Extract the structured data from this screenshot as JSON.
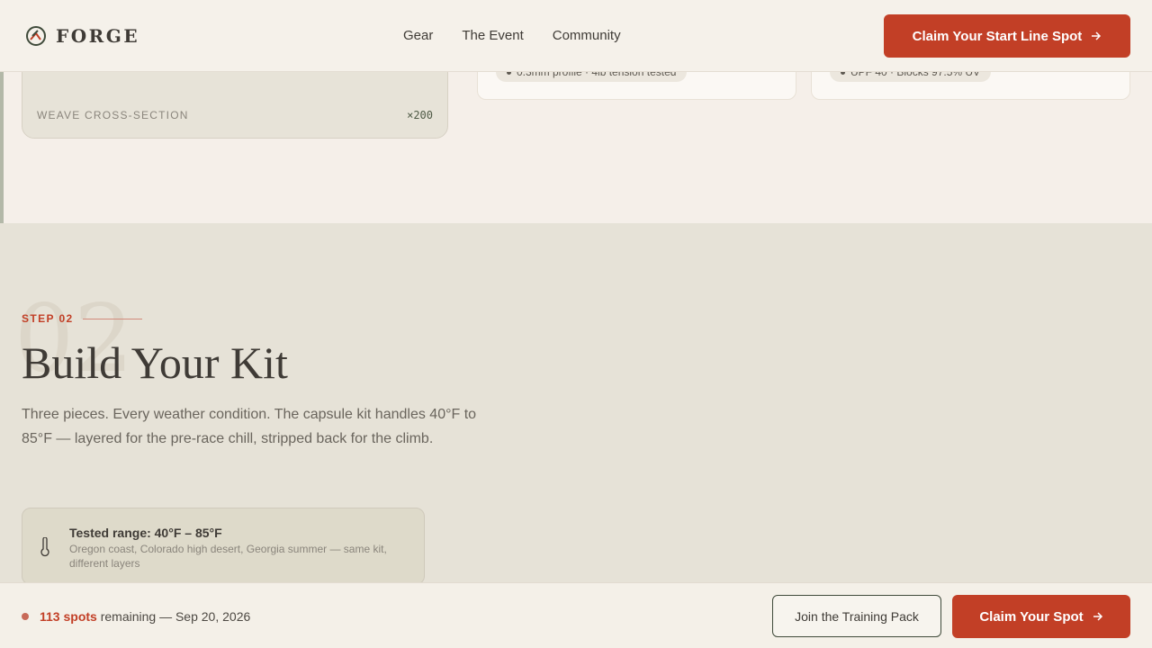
{
  "header": {
    "brand": "FORGE",
    "nav": [
      "Gear",
      "The Event",
      "Community"
    ],
    "cta": "Claim Your Start Line Spot"
  },
  "weave_card": {
    "label": "WEAVE CROSS-SECTION",
    "zoom": "×200"
  },
  "spec_cards": [
    {
      "chip": "0.3mm profile · 4lb tension tested"
    },
    {
      "chip": "UPF 40 · Blocks 97.5% UV"
    }
  ],
  "step": {
    "number": "02",
    "label": "STEP 02",
    "title": "Build Your Kit",
    "lead": "Three pieces. Every weather condition. The capsule kit handles 40°F to 85°F — layered for the pre-race chill, stripped back for the climb."
  },
  "range": {
    "title": "Tested range: 40°F – 85°F",
    "desc": "Oregon coast, Colorado high desert, Georgia summer — same kit, different layers"
  },
  "bottom_bar": {
    "spots_count": "113 spots",
    "spots_rest": " remaining — Sep 20, 2026",
    "secondary": "Join the Training Pack",
    "primary": "Claim Your Spot"
  },
  "colors": {
    "accent": "#c23f26",
    "sage": "#3f4a3a",
    "cream": "#f5efe9"
  },
  "icons": [
    "forge-logo-icon",
    "arrow-right-icon",
    "thermometer-icon",
    "status-dot-icon"
  ]
}
